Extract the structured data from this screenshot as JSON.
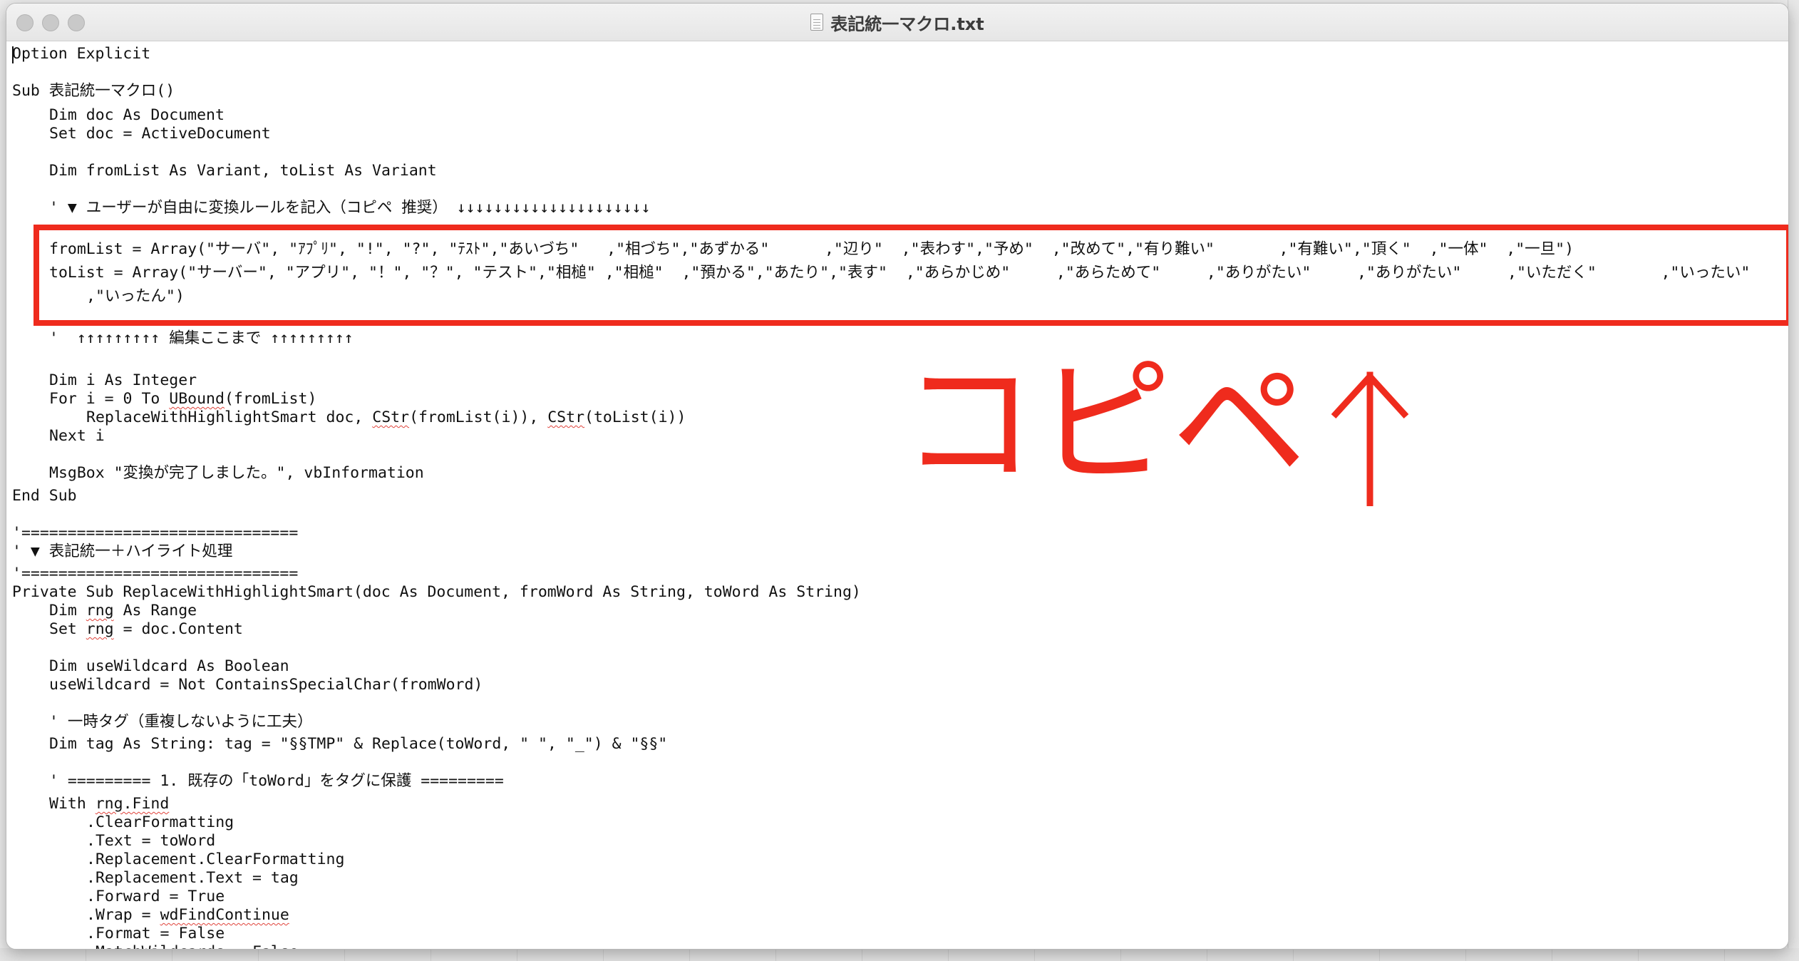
{
  "window": {
    "title": "表記統一マクロ.txt"
  },
  "annotation": {
    "text": "コピペ"
  },
  "code": {
    "l01": "Option Explicit",
    "l02": "Sub 表記統一マクロ()",
    "l03": "Dim doc As Document",
    "l04": "Set doc = ActiveDocument",
    "l05": "Dim fromList As Variant, toList As Variant",
    "l06": "' ▼ ユーザーが自由に変換ルールを記入（コピペ 推奨） ↓↓↓↓↓↓↓↓↓↓↓↓↓↓↓↓↓↓↓↓↓",
    "l07": "fromList = Array(\"サーバ\", \"ｱﾌﾟﾘ\", \"!\", \"?\", \"ﾃｽﾄ\",\"あいづち\"   ,\"相づち\",\"あずかる\"      ,\"辺り\"  ,\"表わす\",\"予め\"  ,\"改めて\",\"有り難い\"       ,\"有難い\",\"頂く\"  ,\"一体\"  ,\"一旦\")",
    "l08": "toList = Array(\"サーバー\", \"アプリ\", \"！\", \"？\", \"テスト\",\"相槌\" ,\"相槌\"  ,\"預かる\",\"あたり\",\"表す\"  ,\"あらかじめ\"     ,\"あらためて\"     ,\"ありがたい\"     ,\"ありがたい\"     ,\"いただく\"       ,\"いったい\"",
    "l09": ",\"いったん\")",
    "l10": "'  ↑↑↑↑↑↑↑↑↑ 編集ここまで ↑↑↑↑↑↑↑↑↑",
    "l11": "Dim i As Integer",
    "l12a": "For i = 0 To ",
    "l12b": "UBound",
    "l12c": "(fromList)",
    "l13a": "ReplaceWithHighlightSmart doc, ",
    "l13b": "CStr",
    "l13c": "(fromList(i)), ",
    "l13d": "CStr",
    "l13e": "(toList(i))",
    "l14": "Next i",
    "l15": "MsgBox \"変換が完了しました。\", vbInformation",
    "l16": "End Sub",
    "l17": "'==============================",
    "l18": "' ▼ 表記統一＋ハイライト処理",
    "l19": "'==============================",
    "l20": "Private Sub ReplaceWithHighlightSmart(doc As Document, fromWord As String, toWord As String)",
    "l21a": "Dim ",
    "l21b": "rng",
    "l21c": " As Range",
    "l22a": "Set ",
    "l22b": "rng",
    "l22c": " = doc.Content",
    "l23": "Dim useWildcard As Boolean",
    "l24": "useWildcard = Not ContainsSpecialChar(fromWord)",
    "l25": "' 一時タグ（重複しないように工夫）",
    "l26": "Dim tag As String: tag = \"§§TMP\" & Replace(toWord, \" \", \"_\") & \"§§\"",
    "l27": "' ========= 1. 既存の「toWord」をタグに保護 =========",
    "l28a": "With ",
    "l28b": "rng.Find",
    "l29": ".ClearFormatting",
    "l30": ".Text = toWord",
    "l31": ".Replacement.ClearFormatting",
    "l32": ".Replacement.Text = tag",
    "l33": ".Forward = True",
    "l34a": ".Wrap = ",
    "l34b": "wdFindContinue",
    "l35": ".Format = False",
    "l36": ".MatchWildcards = False"
  }
}
